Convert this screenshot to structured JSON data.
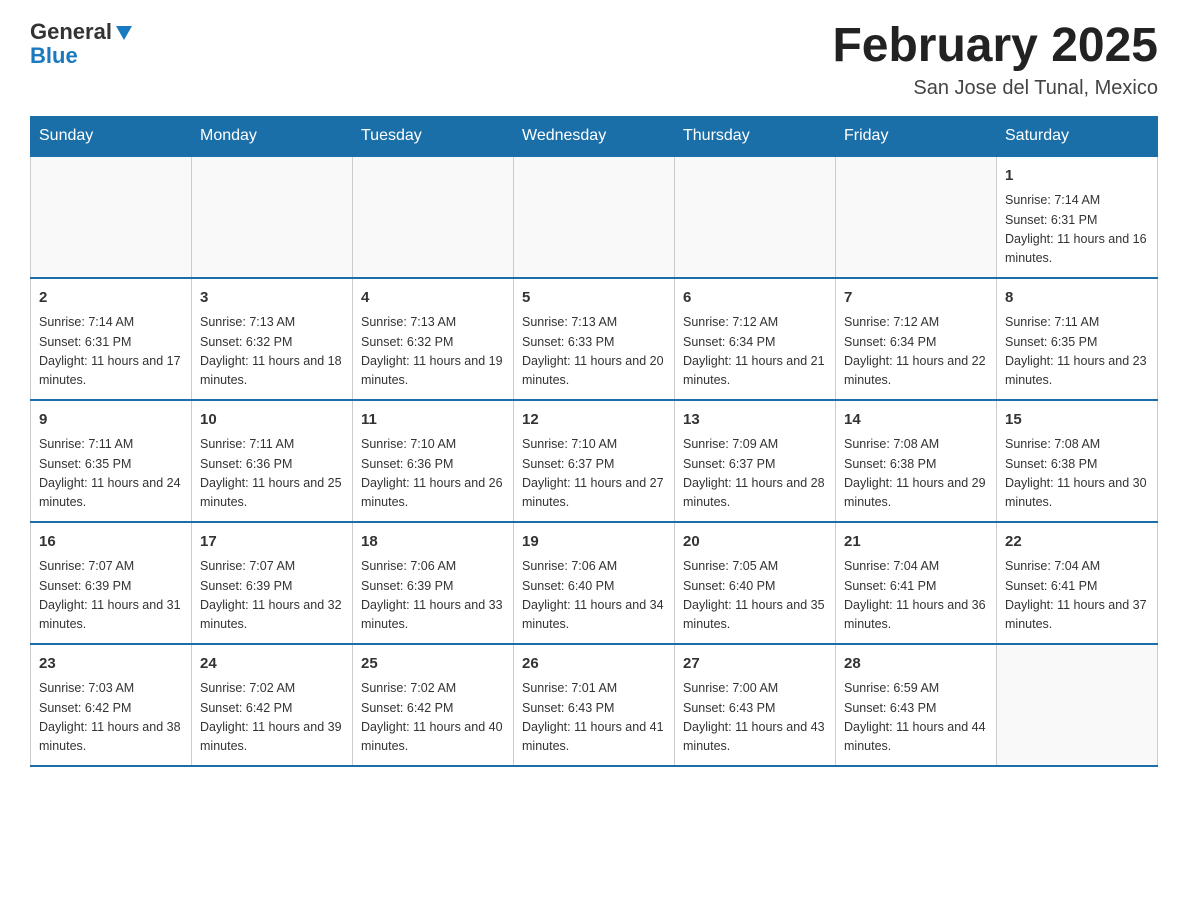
{
  "logo": {
    "text_general": "General",
    "text_blue": "Blue"
  },
  "title": {
    "month_year": "February 2025",
    "location": "San Jose del Tunal, Mexico"
  },
  "weekdays": [
    "Sunday",
    "Monday",
    "Tuesday",
    "Wednesday",
    "Thursday",
    "Friday",
    "Saturday"
  ],
  "weeks": [
    [
      {
        "day": "",
        "info": ""
      },
      {
        "day": "",
        "info": ""
      },
      {
        "day": "",
        "info": ""
      },
      {
        "day": "",
        "info": ""
      },
      {
        "day": "",
        "info": ""
      },
      {
        "day": "",
        "info": ""
      },
      {
        "day": "1",
        "info": "Sunrise: 7:14 AM\nSunset: 6:31 PM\nDaylight: 11 hours and 16 minutes."
      }
    ],
    [
      {
        "day": "2",
        "info": "Sunrise: 7:14 AM\nSunset: 6:31 PM\nDaylight: 11 hours and 17 minutes."
      },
      {
        "day": "3",
        "info": "Sunrise: 7:13 AM\nSunset: 6:32 PM\nDaylight: 11 hours and 18 minutes."
      },
      {
        "day": "4",
        "info": "Sunrise: 7:13 AM\nSunset: 6:32 PM\nDaylight: 11 hours and 19 minutes."
      },
      {
        "day": "5",
        "info": "Sunrise: 7:13 AM\nSunset: 6:33 PM\nDaylight: 11 hours and 20 minutes."
      },
      {
        "day": "6",
        "info": "Sunrise: 7:12 AM\nSunset: 6:34 PM\nDaylight: 11 hours and 21 minutes."
      },
      {
        "day": "7",
        "info": "Sunrise: 7:12 AM\nSunset: 6:34 PM\nDaylight: 11 hours and 22 minutes."
      },
      {
        "day": "8",
        "info": "Sunrise: 7:11 AM\nSunset: 6:35 PM\nDaylight: 11 hours and 23 minutes."
      }
    ],
    [
      {
        "day": "9",
        "info": "Sunrise: 7:11 AM\nSunset: 6:35 PM\nDaylight: 11 hours and 24 minutes."
      },
      {
        "day": "10",
        "info": "Sunrise: 7:11 AM\nSunset: 6:36 PM\nDaylight: 11 hours and 25 minutes."
      },
      {
        "day": "11",
        "info": "Sunrise: 7:10 AM\nSunset: 6:36 PM\nDaylight: 11 hours and 26 minutes."
      },
      {
        "day": "12",
        "info": "Sunrise: 7:10 AM\nSunset: 6:37 PM\nDaylight: 11 hours and 27 minutes."
      },
      {
        "day": "13",
        "info": "Sunrise: 7:09 AM\nSunset: 6:37 PM\nDaylight: 11 hours and 28 minutes."
      },
      {
        "day": "14",
        "info": "Sunrise: 7:08 AM\nSunset: 6:38 PM\nDaylight: 11 hours and 29 minutes."
      },
      {
        "day": "15",
        "info": "Sunrise: 7:08 AM\nSunset: 6:38 PM\nDaylight: 11 hours and 30 minutes."
      }
    ],
    [
      {
        "day": "16",
        "info": "Sunrise: 7:07 AM\nSunset: 6:39 PM\nDaylight: 11 hours and 31 minutes."
      },
      {
        "day": "17",
        "info": "Sunrise: 7:07 AM\nSunset: 6:39 PM\nDaylight: 11 hours and 32 minutes."
      },
      {
        "day": "18",
        "info": "Sunrise: 7:06 AM\nSunset: 6:39 PM\nDaylight: 11 hours and 33 minutes."
      },
      {
        "day": "19",
        "info": "Sunrise: 7:06 AM\nSunset: 6:40 PM\nDaylight: 11 hours and 34 minutes."
      },
      {
        "day": "20",
        "info": "Sunrise: 7:05 AM\nSunset: 6:40 PM\nDaylight: 11 hours and 35 minutes."
      },
      {
        "day": "21",
        "info": "Sunrise: 7:04 AM\nSunset: 6:41 PM\nDaylight: 11 hours and 36 minutes."
      },
      {
        "day": "22",
        "info": "Sunrise: 7:04 AM\nSunset: 6:41 PM\nDaylight: 11 hours and 37 minutes."
      }
    ],
    [
      {
        "day": "23",
        "info": "Sunrise: 7:03 AM\nSunset: 6:42 PM\nDaylight: 11 hours and 38 minutes."
      },
      {
        "day": "24",
        "info": "Sunrise: 7:02 AM\nSunset: 6:42 PM\nDaylight: 11 hours and 39 minutes."
      },
      {
        "day": "25",
        "info": "Sunrise: 7:02 AM\nSunset: 6:42 PM\nDaylight: 11 hours and 40 minutes."
      },
      {
        "day": "26",
        "info": "Sunrise: 7:01 AM\nSunset: 6:43 PM\nDaylight: 11 hours and 41 minutes."
      },
      {
        "day": "27",
        "info": "Sunrise: 7:00 AM\nSunset: 6:43 PM\nDaylight: 11 hours and 43 minutes."
      },
      {
        "day": "28",
        "info": "Sunrise: 6:59 AM\nSunset: 6:43 PM\nDaylight: 11 hours and 44 minutes."
      },
      {
        "day": "",
        "info": ""
      }
    ]
  ]
}
